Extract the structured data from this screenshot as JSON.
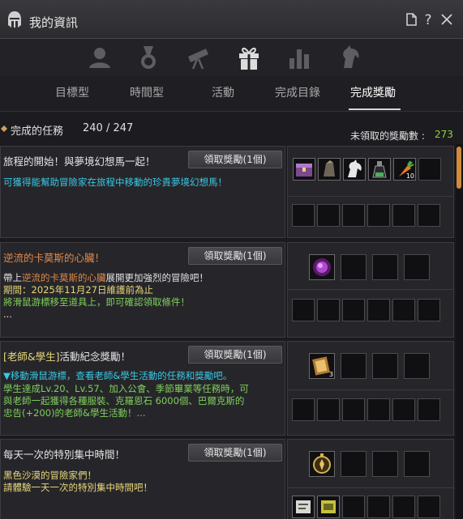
{
  "window": {
    "title": "我的資訊"
  },
  "titlebar_icons": [
    "document-icon",
    "help-icon",
    "close-icon"
  ],
  "tabs": [
    {
      "label": "目標型",
      "active": false
    },
    {
      "label": "時間型",
      "active": false
    },
    {
      "label": "活動",
      "active": false
    },
    {
      "label": "完成目錄",
      "active": false
    },
    {
      "label": "完成獎勵",
      "active": true
    }
  ],
  "summary": {
    "label": "完成的任務",
    "count": "240 / 247",
    "unclaimed_label": "未領取的獎勵數 :",
    "unclaimed_count": "273"
  },
  "quests": [
    {
      "title": "旅程的開始！與夢境幻想馬一起！",
      "button": "領取獎勵(1個)",
      "desc_line1": "可獲得能幫助冒險家在旅程中移動的珍貴夢境幻想馬！",
      "reward_qty": "10"
    },
    {
      "title": "逆流的卡莫斯的心臟！",
      "button": "領取獎勵(1個)",
      "desc_l1_pre": "帶上",
      "desc_l1_hl": "逆流的卡莫斯的心臟",
      "desc_l1_post": "展開更加強烈的冒險吧！",
      "desc_l2": "期間：2025年11月27日維護前為止",
      "desc_l3": "將滑鼠游標移至道具上，即可確認領取條件！",
      "desc_l4": "..."
    },
    {
      "title_hl": "[老師&學生]",
      "title_rest": "活動紀念獎勵！",
      "button": "領取獎勵(1個)",
      "desc_l1": "▼移動滑鼠游標，查看老師&學生活動的任務和獎勵吧。",
      "desc_l2": "學生達成Lv.20、Lv.57、加入公會、季節畢業等任務時，可",
      "desc_l3": "與老師一起獲得各種服裝、克羅恩石 6000個、巴爾克斯的",
      "desc_l4": "忠告(+200)的老師&學生活動！...",
      "reward_qty": "3"
    },
    {
      "title": "每天一次的特別集中時間！",
      "button": "領取獎勵(1個)",
      "desc_l1": "黑色沙漠的冒險家們！",
      "desc_l2": "請體驗一天一次的特別集中時間吧！"
    }
  ],
  "colors": {
    "accent_green": "#7fd05a",
    "accent_cyan": "#39c8e6",
    "accent_orange": "#e0884a",
    "scroll": "#d08a3a"
  }
}
